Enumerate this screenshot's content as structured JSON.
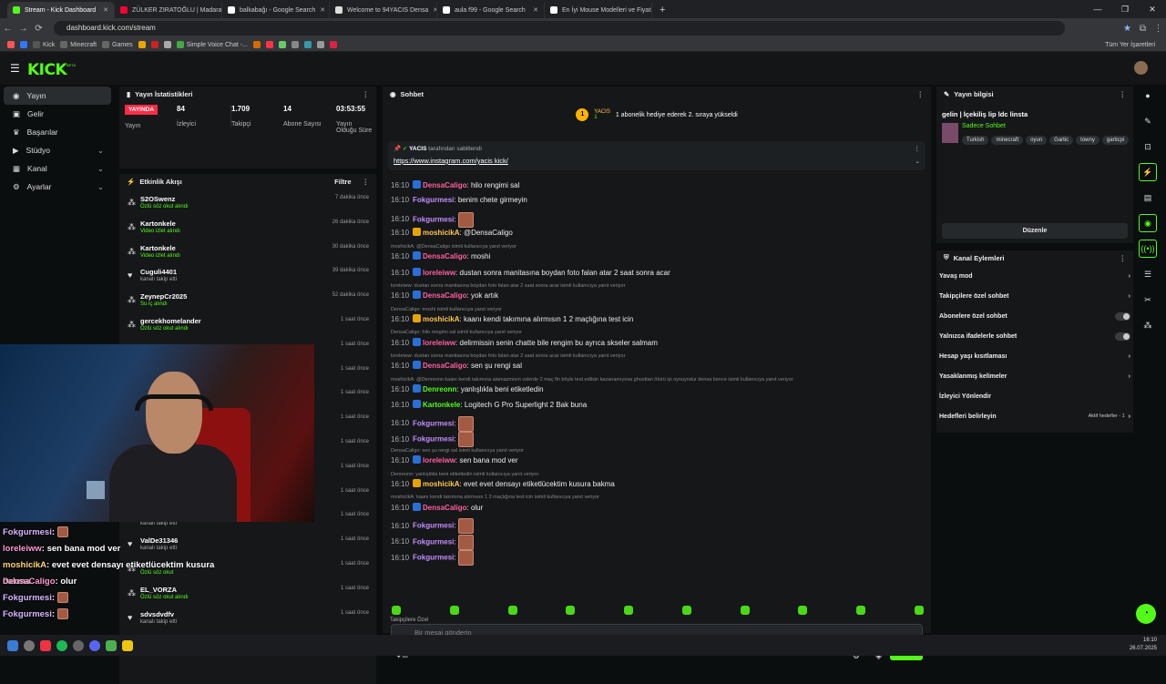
{
  "browser": {
    "tabs": [
      {
        "label": "Stream - Kick Dashboard",
        "color": "#53fc18",
        "active": true
      },
      {
        "label": "ZÜLKER ZIRATOĞLU | Madara C",
        "color": "#ff0033"
      },
      {
        "label": "balkabağı - Google Search",
        "color": "#ffffff"
      },
      {
        "label": "Welcome to 94YACIS Densa",
        "color": "#dddddd"
      },
      {
        "label": "aula f99 - Google Search",
        "color": "#ffffff"
      },
      {
        "label": "En İyi Mouse Modelleri ve Fiyatı",
        "color": "#ffffff"
      }
    ],
    "url": "dashboard.kick.com/stream",
    "bookmarks": [
      "Kick",
      "Minecraft",
      "Games",
      "Simple Voice Chat -..."
    ],
    "all_bookmarks": "Tüm Yer İşaretleri"
  },
  "app": {
    "logo": "KICK",
    "sup": "BETA"
  },
  "sidebar": {
    "items": [
      {
        "label": "Yayın",
        "icon": "broadcast-icon"
      },
      {
        "label": "Gelir",
        "icon": "wallet-icon"
      },
      {
        "label": "Başarılar",
        "icon": "trophy-icon"
      },
      {
        "label": "Stüdyo",
        "icon": "studio-icon",
        "chev": "⌄"
      },
      {
        "label": "Kanal",
        "icon": "channel-icon",
        "chev": "⌄"
      },
      {
        "label": "Ayarlar",
        "icon": "gear-icon",
        "chev": "⌄"
      }
    ]
  },
  "stats": {
    "title": "Yayın İstatistikleri",
    "live": "YAYINDA",
    "live_label": "Yayın",
    "viewers": "84",
    "viewers_label": "İzleyici",
    "followers": "1.709",
    "followers_label": "Takipçi",
    "subs": "14",
    "subs_label": "Abone Sayısı",
    "uptime": "03:53:55",
    "uptime_label": "Yayın Olduğu Süre"
  },
  "activity": {
    "title": "Etkinlik Akışı",
    "filter": "Filtre",
    "items": [
      {
        "name": "S2OSwenz",
        "desc": "Özlü söz okut alındı",
        "time": "7 dakika önce",
        "type": "g"
      },
      {
        "name": "Kartonkele",
        "desc": "Video izlet alındı",
        "time": "26 dakika önce",
        "type": "g"
      },
      {
        "name": "Kartonkele",
        "desc": "Video izlet alındı",
        "time": "30 dakika önce",
        "type": "g"
      },
      {
        "name": "Cuguli4401",
        "desc": "kanalı takip etti",
        "time": "39 dakika önce",
        "type": "f"
      },
      {
        "name": "ZeynepCr2025",
        "desc": "Su iç alındı",
        "time": "52 dakika önce",
        "type": "g"
      },
      {
        "name": "gercekhomelander",
        "desc": "Özlü söz okut alındı",
        "time": "1 saat önce",
        "type": "g"
      },
      {
        "name": "",
        "desc": "",
        "time": "1 saat önce",
        "type": "g"
      },
      {
        "name": "",
        "desc": "",
        "time": "1 saat önce",
        "type": "g"
      },
      {
        "name": "",
        "desc": "",
        "time": "1 saat önce",
        "type": "g"
      },
      {
        "name": "",
        "desc": "",
        "time": "1 saat önce",
        "type": "g"
      },
      {
        "name": "",
        "desc": "",
        "time": "1 saat önce",
        "type": "g"
      },
      {
        "name": "",
        "desc": "",
        "time": "1 saat önce",
        "type": "g"
      },
      {
        "name": "",
        "desc": "",
        "time": "1 saat önce",
        "type": "g"
      },
      {
        "name": "",
        "desc": "kanalı takip etti",
        "time": "1 saat önce",
        "type": "f"
      },
      {
        "name": "ValDe31346",
        "desc": "kanalı takip etti",
        "time": "1 saat önce",
        "type": "f"
      },
      {
        "name": "",
        "desc": "Özlü söz okut",
        "time": "1 saat önce",
        "type": "g"
      },
      {
        "name": "EL_VORZA",
        "desc": "Özlü söz okut alındı",
        "time": "1 saat önce",
        "type": "g"
      },
      {
        "name": "sdvsdvdfv",
        "desc": "kanalı takip etti",
        "time": "1 saat önce",
        "type": "f"
      }
    ]
  },
  "chat": {
    "title": "Sohbet",
    "banner_user": "YACIS",
    "banner_count": "1",
    "banner_text": "1 abonelik hediye ederek 2. sıraya yükseldi",
    "pinned_by": "YACIS",
    "pinned_label": "tarafından sabitlendi",
    "pinned_link": "https://www.instagram.com/yacis kick/",
    "messages": [
      {
        "time": "16:10",
        "user": "DensaCaligo",
        "c": "pink",
        "text": "hilo rengimi sal"
      },
      {
        "time": "16:10",
        "user": "Fokgurmesi",
        "c": "purple",
        "text": "benim chete girmeyin"
      },
      {
        "time": "16:10",
        "user": "Fokgurmesi",
        "c": "purple",
        "text": "",
        "emote": true
      },
      {
        "time": "16:10",
        "user": "moshicikA",
        "c": "gold",
        "text": "@DensaCaligo"
      },
      {
        "reply": "moshicikA: @DensaCaligo isimli kullanıcıya yanıt veriyor"
      },
      {
        "time": "16:10",
        "user": "DensaCaligo",
        "c": "pink",
        "text": "moshi"
      },
      {
        "time": "16:10",
        "user": "loreleiww",
        "c": "pink",
        "text": "dustan sonra manitasına boydan foto falan atar 2 saat sonra acar"
      },
      {
        "reply": "loreleiww: dustan sonra manitasına boydan foto falan atar 2 saat sonra acar isimli kullanıcıya yanıt veriyor"
      },
      {
        "time": "16:10",
        "user": "DensaCaligo",
        "c": "pink",
        "text": "yok artık"
      },
      {
        "reply": "DensaCaligo: moshi isimli kullanıcıya yanıt veriyor"
      },
      {
        "time": "16:10",
        "user": "moshicikA",
        "c": "gold",
        "text": "kaanı kendi takımına alırmısın 1 2 maçlığına test icin"
      },
      {
        "reply": "DensaCaligo: hilo rengimi sal isimli kullanıcıya yanıt veriyor"
      },
      {
        "time": "16:10",
        "user": "loreleiww",
        "c": "pink",
        "text": "delirmissin senin chatte bile rengim bu ayrıca skseler salmam"
      },
      {
        "reply": "loreleiww: dustan sonra manitasına boydan foto falan atar 2 saat sonra acar isimli kullanıcıya yanıt veriyor"
      },
      {
        "time": "16:10",
        "user": "DensaCaligo",
        "c": "pink",
        "text": "sen şu rengi sal"
      },
      {
        "reply": "moshicikA: @Denreonn kaanı kendi takımına alamazmısın vslerde 2 maç fln böyle test edilsin kazanamıyosa ghosttan ötürü iyi oynuyodur densa bence isimli kullanıcıya yanıt veriyor"
      },
      {
        "time": "16:10",
        "user": "Denreonn",
        "c": "green",
        "text": "yanlışlıkla beni etiketledin"
      },
      {
        "time": "16:10",
        "user": "Kartonkele",
        "c": "green",
        "text": "Logitech G Pro Superlight 2 Bak buna"
      },
      {
        "time": "16:10",
        "user": "Fokgurmesi",
        "c": "purple",
        "text": "",
        "emote": true
      },
      {
        "time": "16:10",
        "user": "Fokgurmesi",
        "c": "purple",
        "text": "",
        "emote": true
      },
      {
        "reply": "DensaCaligo: sen şu rengi sal isimli kullanıcıya yanıt veriyor"
      },
      {
        "time": "16:10",
        "user": "loreleiww",
        "c": "pink",
        "text": "sen bana mod ver"
      },
      {
        "reply": "Denreonn: yanlışlıkla beni etiketledin isimli kullanıcıya yanıt veriyor"
      },
      {
        "time": "16:10",
        "user": "moshicikA",
        "c": "gold",
        "text": "evet evet densayı etiketlücektim kusura bakma"
      },
      {
        "reply": "moshicikA: kaanı kendi takımına alırmısın 1 2 maçlığına test icin isimli kullanıcıya yanıt veriyor"
      },
      {
        "time": "16:10",
        "user": "DensaCaligo",
        "c": "pink",
        "text": "olur"
      },
      {
        "time": "16:10",
        "user": "Fokgurmesi",
        "c": "purple",
        "text": "",
        "emote": true
      },
      {
        "time": "16:10",
        "user": "Fokgurmesi",
        "c": "purple",
        "text": "",
        "emote": true
      },
      {
        "time": "16:10",
        "user": "Fokgurmesi",
        "c": "purple",
        "text": "",
        "emote": true
      }
    ],
    "followers_only_label": "Takipçilere Özel",
    "input_placeholder": "Bir mesaj gönderin",
    "send": "Gönder"
  },
  "info": {
    "title": "Yayın bilgisi",
    "stream_title": "gelin | İçekiliş lip ldc linsta",
    "category": "Sadece Sohbet",
    "tags": [
      "Turkish",
      "minecraft",
      "oyun",
      "Gartic",
      "towny",
      "garticpi"
    ],
    "edit": "Düzenle"
  },
  "channel": {
    "title": "Kanal Eylemleri",
    "items": [
      {
        "label": "Yavaş mod",
        "ctl": "›"
      },
      {
        "label": "Takipçilere özel sohbet",
        "ctl": "›"
      },
      {
        "label": "Abonelere özel sohbet",
        "ctl": "toggle"
      },
      {
        "label": "Yalnızca ifadelerle sohbet",
        "ctl": "toggle"
      },
      {
        "label": "Hesap yaşı kısıtlaması",
        "ctl": "›"
      },
      {
        "label": "Yasaklanmış kelimeler",
        "ctl": "›"
      },
      {
        "label": "İzleyici Yönlendir",
        "ctl": ""
      },
      {
        "label": "Hedefleri belirleyin",
        "ctl": "›",
        "extra": "Aktif hedefler - 1"
      }
    ]
  },
  "overlay": [
    {
      "user": "Fokgurmesi",
      "text": "",
      "c": "#d9b3ff"
    },
    {
      "user": "loreleiww",
      "text": "sen bana mod ver",
      "c": "#ff9ad0"
    },
    {
      "user": "moshicikA",
      "text": "evet evet densayı etiketlücektim kusura bakma",
      "c": "#ffd27a"
    },
    {
      "user": "DensaCaligo",
      "text": "olur",
      "c": "#ff9ad0"
    },
    {
      "user": "Fokgurmesi",
      "text": "",
      "c": "#d9b3ff"
    },
    {
      "user": "Fokgurmesi",
      "text": "",
      "c": "#d9b3ff"
    }
  ],
  "clock": {
    "time": "16:10",
    "date": "26.07.2025"
  }
}
